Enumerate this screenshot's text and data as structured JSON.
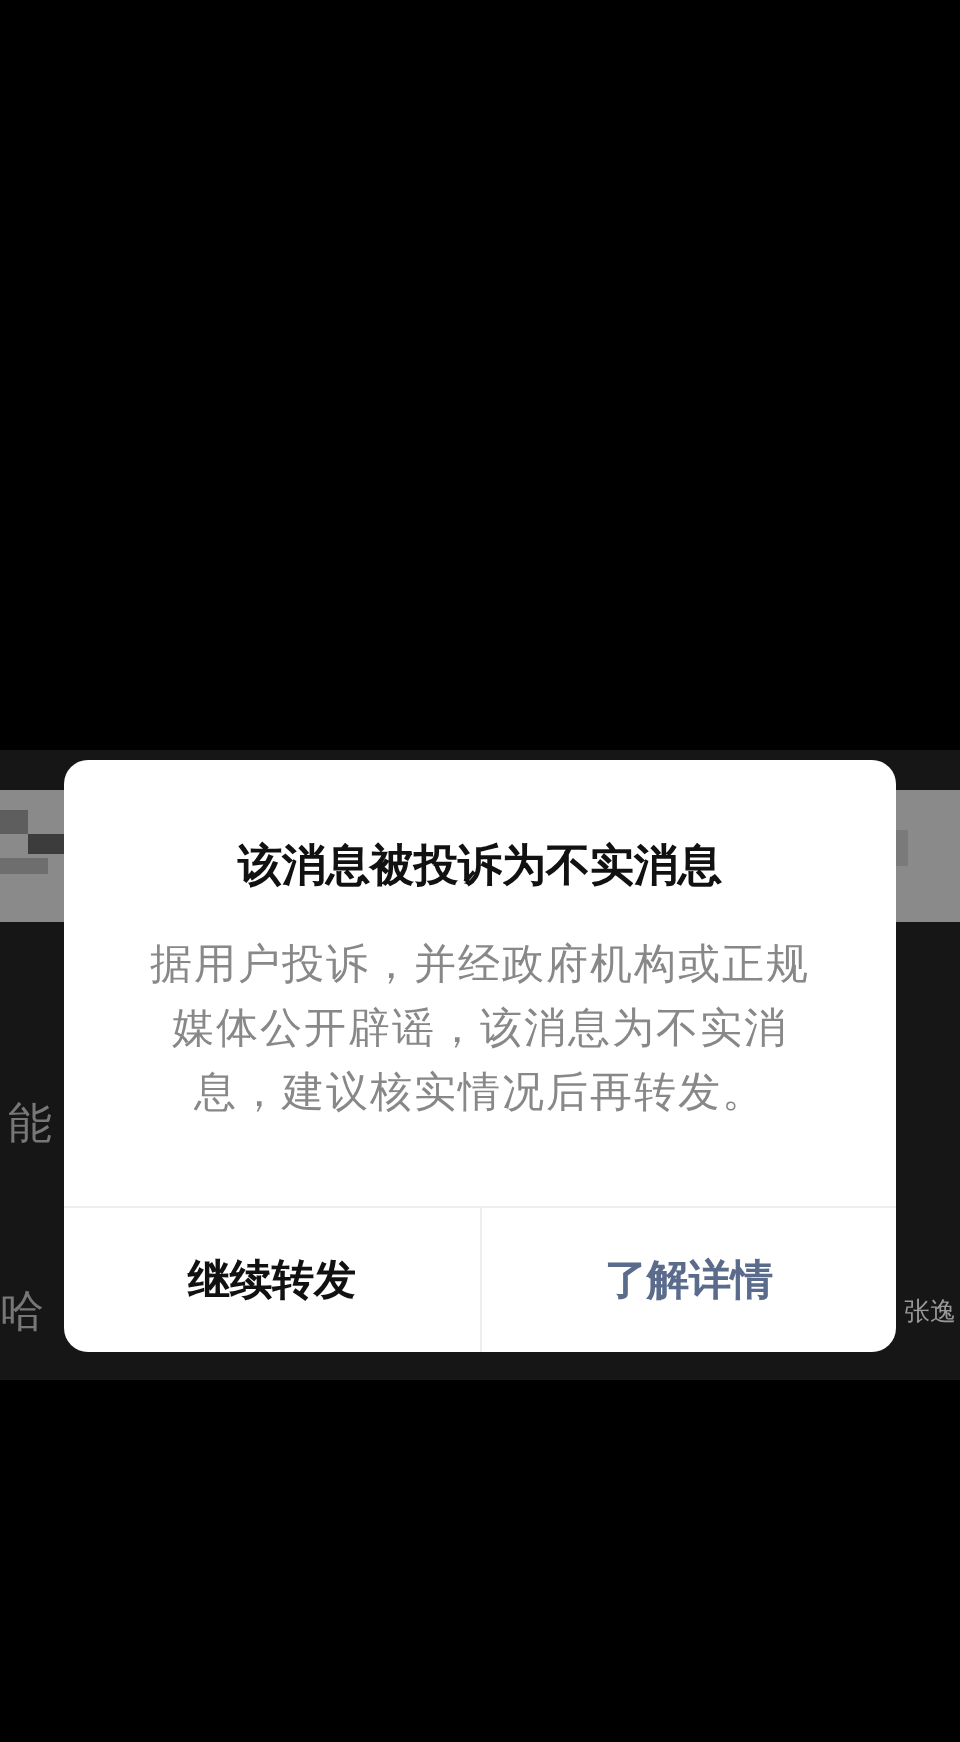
{
  "background": {
    "fragments": [
      {
        "text": "能"
      },
      {
        "text": "哈"
      },
      {
        "text": "张逸"
      }
    ]
  },
  "dialog": {
    "title": "该消息被投诉为不实消息",
    "message": "据用户投诉，并经政府机构或正规媒体公开辟谣，该消息为不实消息，建议核实情况后再转发。",
    "buttons": [
      {
        "label": "继续转发",
        "kind": "secondary"
      },
      {
        "label": "了解详情",
        "kind": "primary"
      }
    ]
  }
}
